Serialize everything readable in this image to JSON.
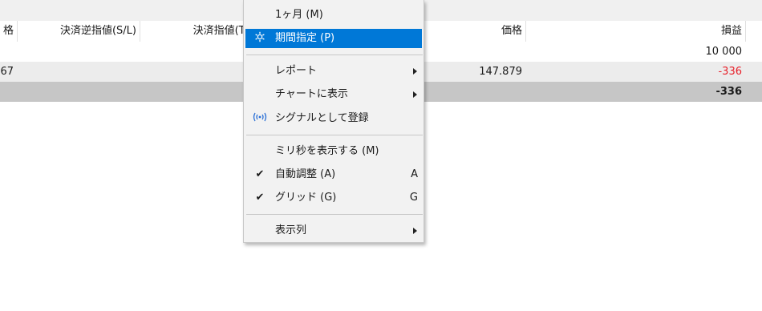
{
  "header": {
    "col_price_trunc": "格",
    "col_sl": "決済逆指値(S/L)",
    "col_tp": "決済指値(T/",
    "col_price": "価格",
    "col_profit": "損益"
  },
  "rows": {
    "balance_profit": "10 000",
    "deal_price_trunc": "67",
    "deal_price": "147.879",
    "deal_profit": "-336",
    "total_profit": "-336"
  },
  "menu": {
    "items": [
      {
        "label": "1ヶ月 (M)"
      },
      {
        "label": "期間指定 (P)",
        "icon": "gear-icon"
      },
      {
        "label": "レポート",
        "submenu": true
      },
      {
        "label": "チャートに表示",
        "submenu": true
      },
      {
        "label": "シグナルとして登録",
        "icon": "signal-icon"
      },
      {
        "label": "ミリ秒を表示する (M)"
      },
      {
        "label": "自動調整 (A)",
        "shortcut": "A",
        "checked": true
      },
      {
        "label": "グリッド (G)",
        "shortcut": "G",
        "checked": true
      },
      {
        "label": "表示列",
        "submenu": true
      }
    ],
    "check_glyph": "✔"
  },
  "colors": {
    "highlight": "#0078d7",
    "negative": "#e8202a",
    "signal_icon": "#2a6fd6",
    "total_row": "#c6c6c6"
  }
}
